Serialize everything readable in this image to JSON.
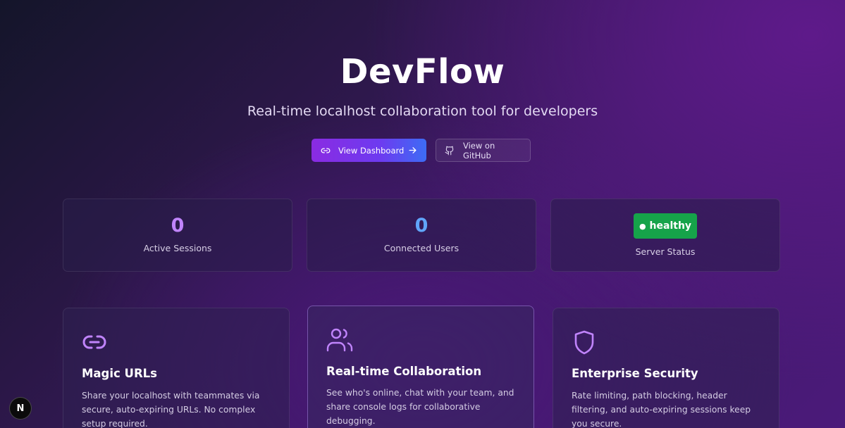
{
  "hero": {
    "title": "DevFlow",
    "subtitle": "Real-time localhost collaboration tool for developers",
    "primary_button": {
      "label": "View Dashboard",
      "icon": "link-icon",
      "trailing_icon": "arrow-right-icon"
    },
    "secondary_button": {
      "label": "View on GitHub",
      "icon": "github-icon"
    }
  },
  "stats": [
    {
      "value": "0",
      "label": "Active Sessions",
      "color": "#c084fc"
    },
    {
      "value": "0",
      "label": "Connected Users",
      "color": "#60a5fa"
    },
    {
      "badge": "healthy",
      "label": "Server Status",
      "color": "#16a34a"
    }
  ],
  "features": [
    {
      "icon": "link-icon",
      "title": "Magic URLs",
      "description": "Share your localhost with teammates via secure, auto-expiring URLs. No complex setup required."
    },
    {
      "icon": "users-icon",
      "title": "Real-time Collaboration",
      "description": "See who's online, chat with your team, and share console logs for collaborative debugging."
    },
    {
      "icon": "shield-icon",
      "title": "Enterprise Security",
      "description": "Rate limiting, path blocking, header filtering, and auto-expiring sessions keep you secure."
    }
  ],
  "dev_badge": {
    "label": "N",
    "icon": "nextjs-icon"
  },
  "colors": {
    "accent": "#c084fc",
    "primary_gradient_start": "#8a2be2",
    "primary_gradient_end": "#3d6cf5",
    "healthy": "#16a34a"
  }
}
